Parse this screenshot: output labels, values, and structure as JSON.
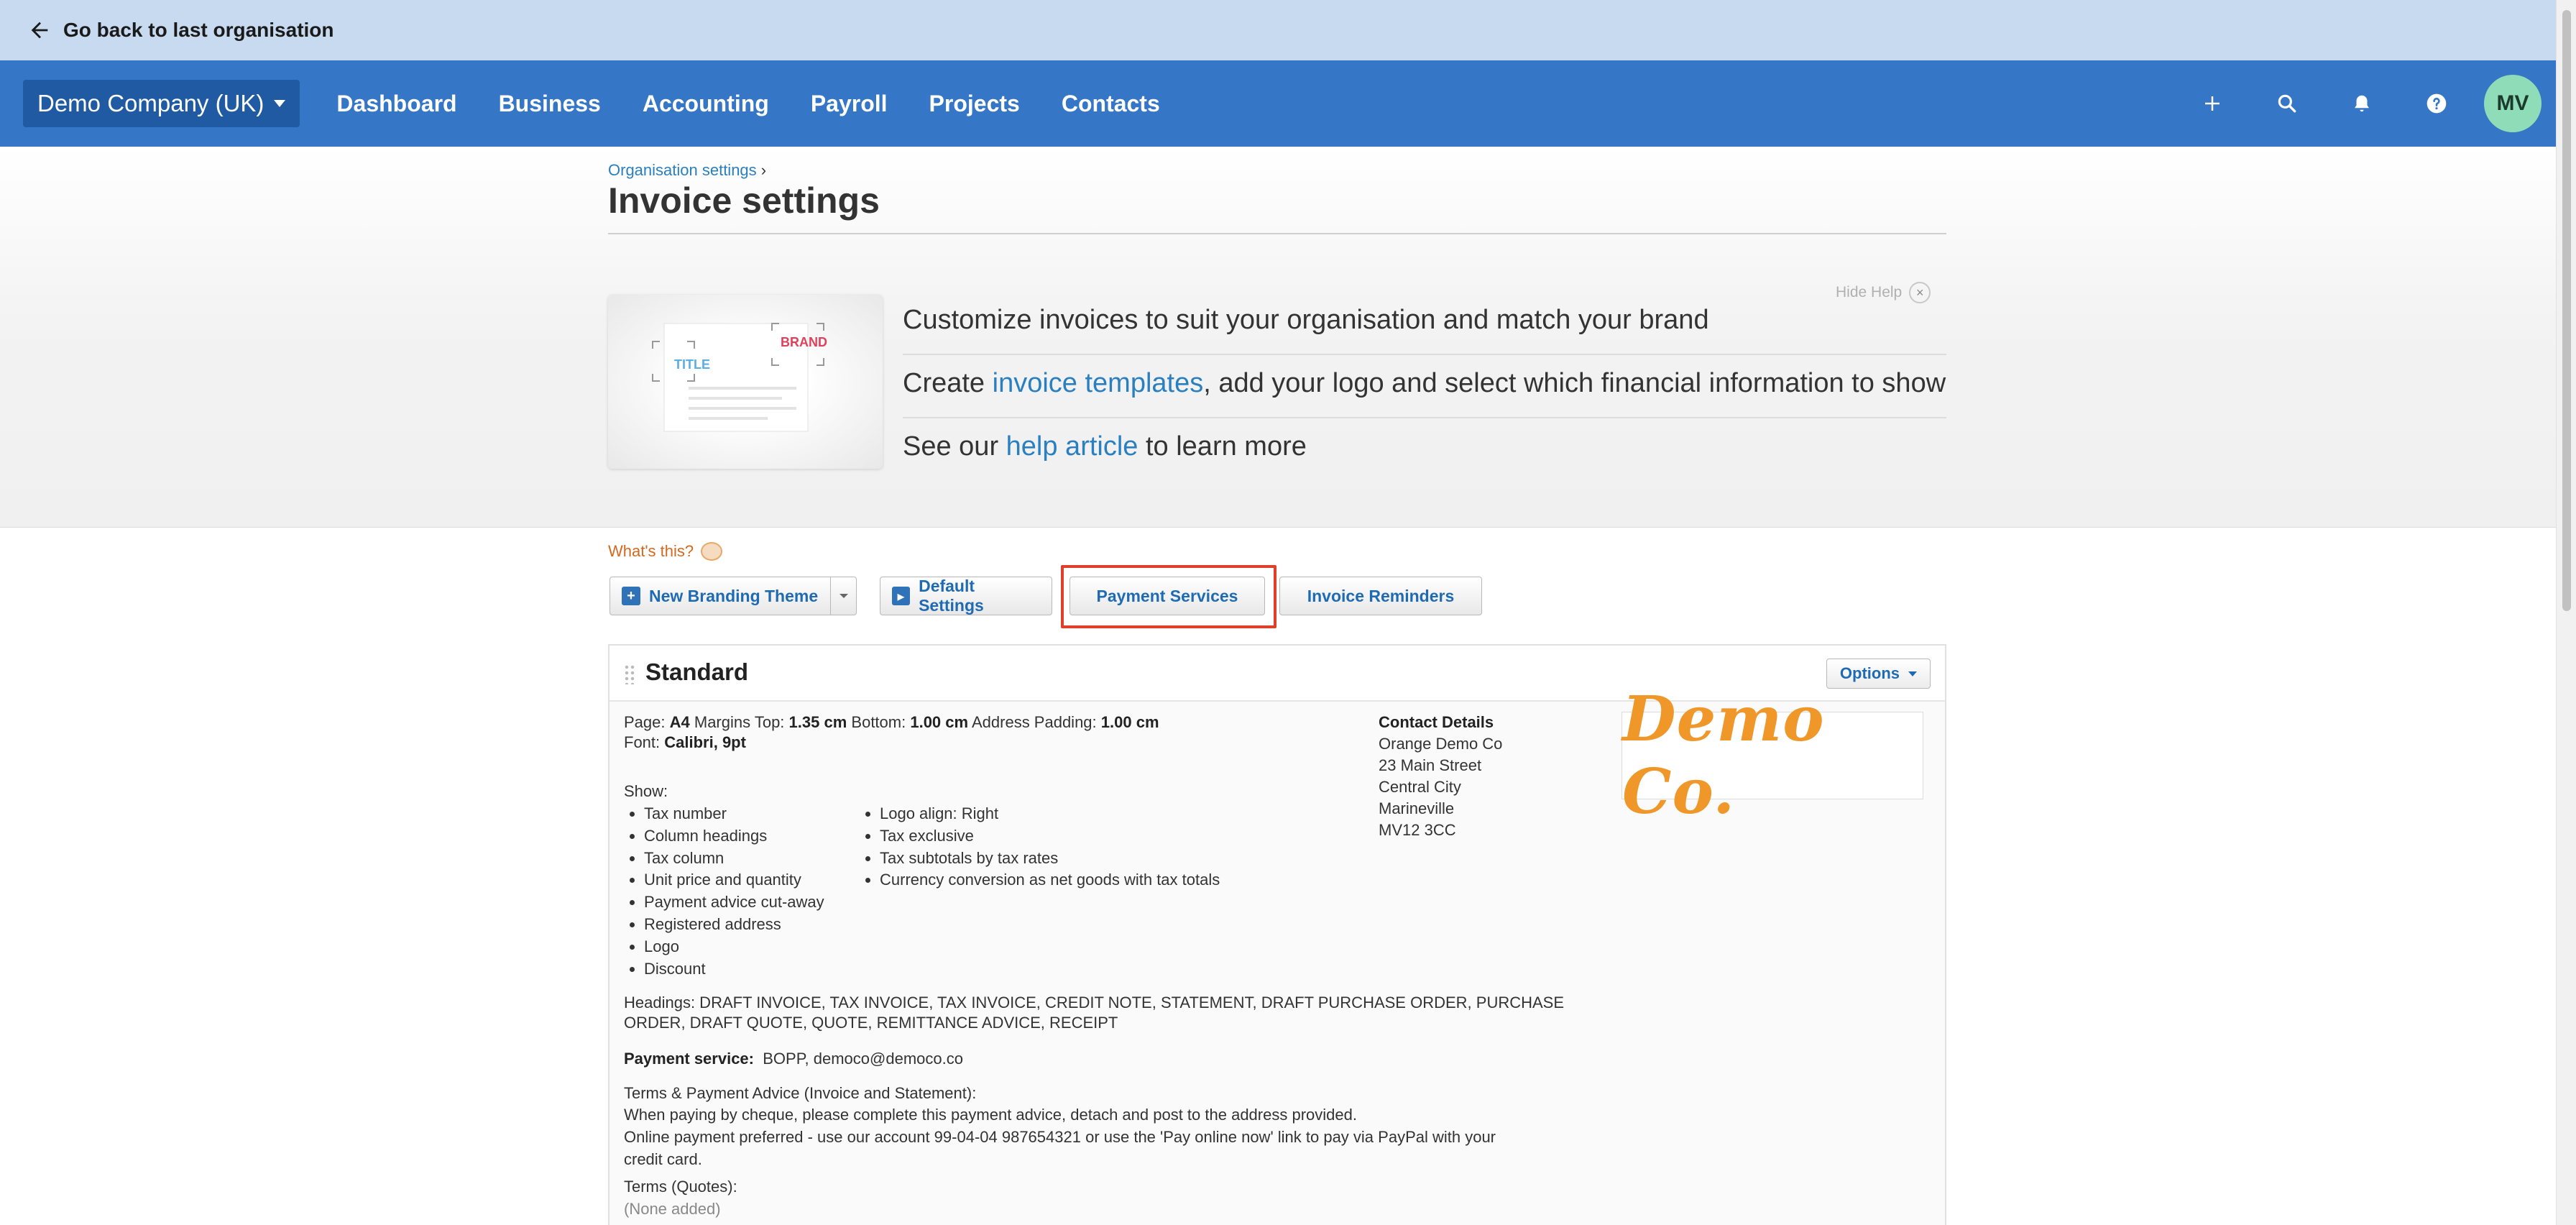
{
  "backbar": {
    "label": "Go back to last organisation"
  },
  "nav": {
    "org": "Demo Company (UK)",
    "links": [
      "Dashboard",
      "Business",
      "Accounting",
      "Payroll",
      "Projects",
      "Contacts"
    ],
    "avatar": "MV"
  },
  "header": {
    "breadcrumb": "Organisation settings",
    "breadcrumb_sep": "›",
    "title": "Invoice settings",
    "hide_help": "Hide Help",
    "help_image": {
      "title": "TITLE",
      "brand": "BRAND"
    },
    "line1": "Customize invoices to suit your organisation and match your brand",
    "line2_pre": "Create ",
    "line2_link": "invoice templates",
    "line2_post": ", add your logo and select which financial information to show",
    "line3_pre": "See our ",
    "line3_link": "help article",
    "line3_post": " to learn more"
  },
  "whats_this": "What's this?",
  "buttons": {
    "new_theme": "New Branding Theme",
    "default_settings": "Default Settings",
    "payment_services": "Payment Services",
    "invoice_reminders": "Invoice Reminders"
  },
  "theme": {
    "name": "Standard",
    "options": "Options",
    "page_label": "Page:",
    "page": "A4",
    "margins_top_label": "Margins Top:",
    "margins_top": "1.35 cm",
    "bottom_label": "Bottom:",
    "bottom": "1.00 cm",
    "address_padding_label": "Address Padding:",
    "address_padding": "1.00 cm",
    "font_label": "Font:",
    "font": "Calibri, 9pt",
    "show_label": "Show:",
    "show_col1": [
      "Tax number",
      "Column headings",
      "Tax column",
      "Unit price and quantity",
      "Payment advice cut-away",
      "Registered address",
      "Logo",
      "Discount"
    ],
    "show_col2": [
      "Logo align: Right",
      "Tax exclusive",
      "Tax subtotals by tax rates",
      "Currency conversion as net goods with tax totals"
    ],
    "headings_line1": "Headings: DRAFT INVOICE, TAX INVOICE, TAX INVOICE, CREDIT NOTE, STATEMENT, DRAFT PURCHASE ORDER, PURCHASE",
    "headings_line2": "ORDER, DRAFT QUOTE, QUOTE, REMITTANCE ADVICE, RECEIPT",
    "payment_service_label": "Payment service:",
    "payment_service": "BOPP, democo@democo.co",
    "terms_label": "Terms & Payment Advice (Invoice and Statement):",
    "terms_line1": "When paying by cheque, please complete this payment advice, detach and post to the address provided.",
    "terms_line2": "Online payment preferred - use our account 99-04-04 987654321 or use the 'Pay online now' link to pay via PayPal with your",
    "terms_line3": "credit card.",
    "terms_quotes_label": "Terms (Quotes):",
    "terms_quotes": "(None added)",
    "contact_label": "Contact Details",
    "contact_lines": [
      "Orange Demo Co",
      "23 Main Street",
      "Central City",
      "Marineville",
      "MV12 3CC"
    ],
    "logo_text": "Demo Co."
  }
}
